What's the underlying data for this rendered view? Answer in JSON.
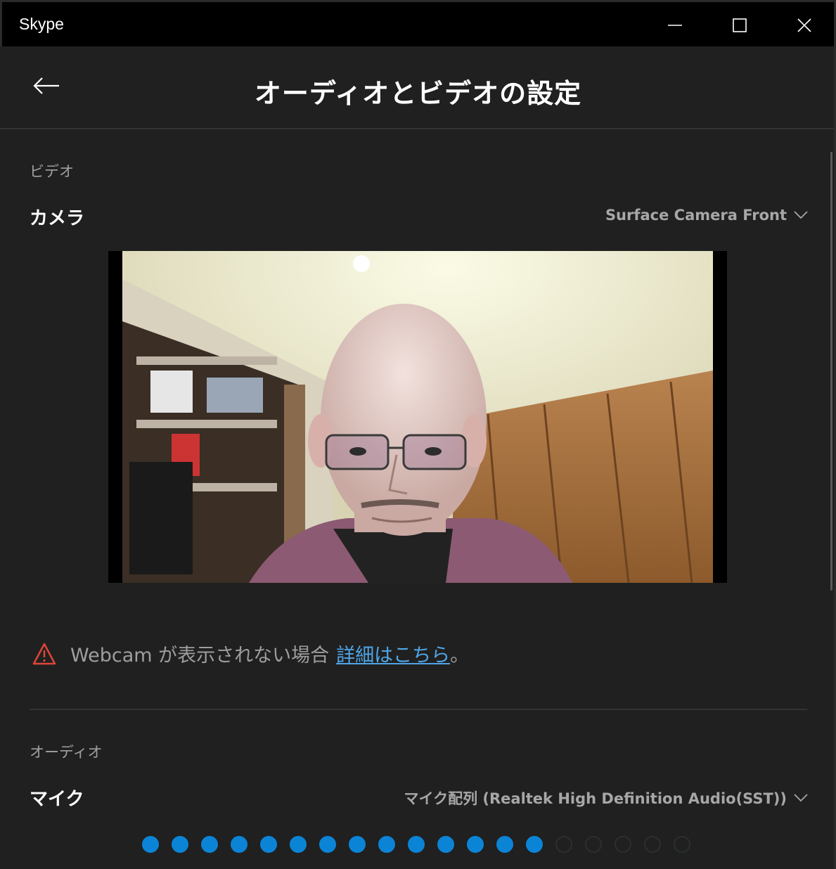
{
  "window": {
    "title": "Skype",
    "controls": {
      "minimize": "minimize-icon",
      "maximize": "maximize-icon",
      "close": "close-icon"
    }
  },
  "header": {
    "back_icon": "arrow-left-icon",
    "title": "オーディオとビデオの設定"
  },
  "video": {
    "section_label": "ビデオ",
    "camera_label": "カメラ",
    "camera_selected": "Surface Camera Front",
    "preview_alt": "camera-preview",
    "warning_text": "Webcam が表示されない場合",
    "warning_link": "詳細はこちら",
    "warning_suffix": "。"
  },
  "audio": {
    "section_label": "オーディオ",
    "mic_label": "マイク",
    "mic_selected": "マイク配列 (Realtek High Definition Audio(SST))",
    "mic_level": {
      "active": 14,
      "total": 19
    }
  },
  "colors": {
    "background": "#202020",
    "titlebar": "#000000",
    "accent": "#0b84d6",
    "link": "#4ea6e8",
    "warning": "#e0453a"
  }
}
